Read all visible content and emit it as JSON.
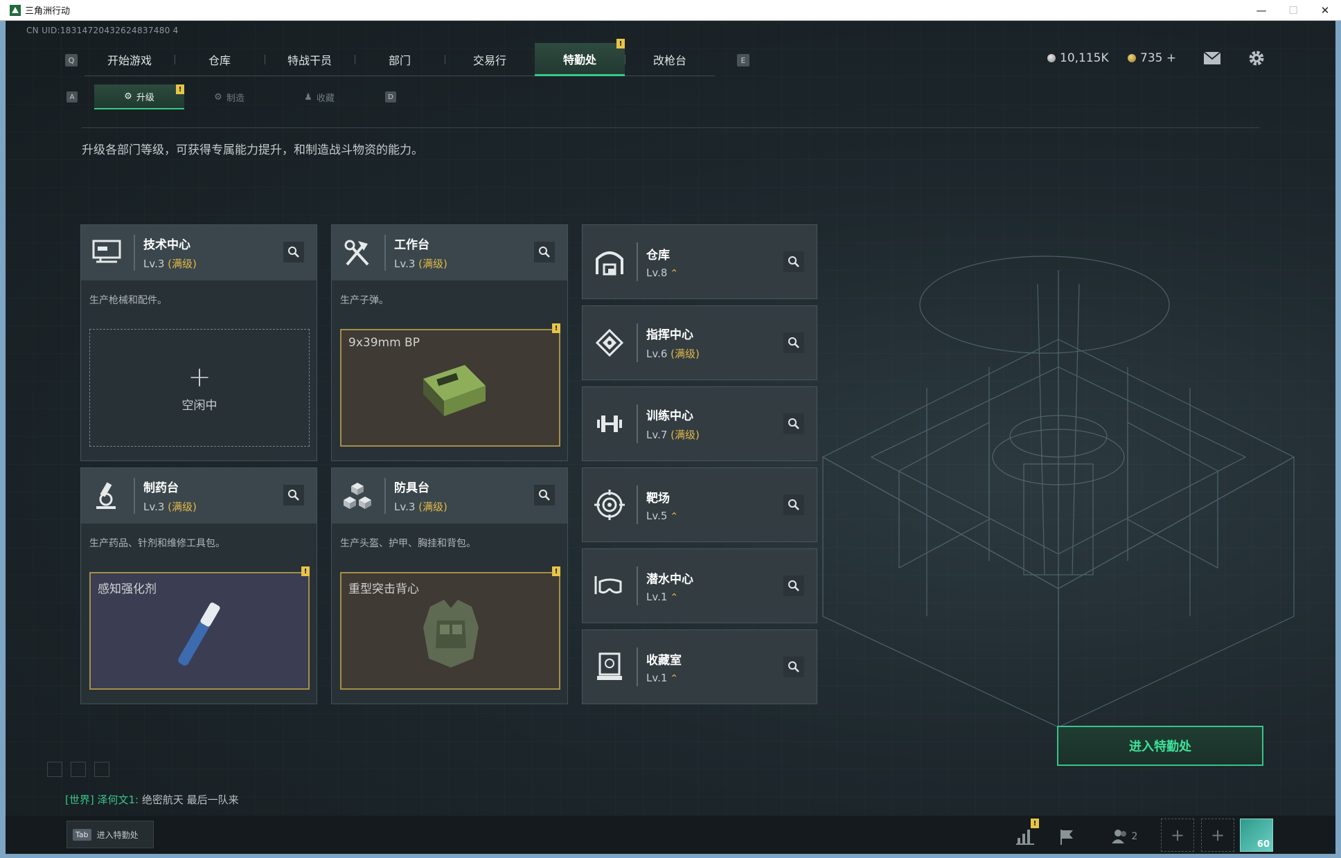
{
  "window": {
    "title": "三角洲行动",
    "controls": [
      "minimize",
      "maximize",
      "close"
    ]
  },
  "uid": "CN UID:18314720432624837480 4",
  "nav": {
    "left_key": "Q",
    "right_key": "E",
    "tabs": [
      {
        "label": "开始游戏"
      },
      {
        "label": "仓库"
      },
      {
        "label": "特战干员"
      },
      {
        "label": "部门"
      },
      {
        "label": "交易行"
      },
      {
        "label": "特勤处",
        "active": true,
        "badge": "!"
      },
      {
        "label": "改枪台"
      }
    ]
  },
  "currency": {
    "silver": "10,115K",
    "gold": "735 +"
  },
  "subnav": {
    "left_key": "A",
    "right_key": "D",
    "tabs": [
      {
        "label": "升级",
        "active": true,
        "badge": "!"
      },
      {
        "label": "制造"
      },
      {
        "label": "收藏"
      }
    ]
  },
  "description": "升级各部门等级，可获得专属能力提升，和制造战斗物资的能力。",
  "facilities": [
    {
      "name": "技术中心",
      "level": "Lv.3",
      "max": "(满级)",
      "desc": "生产枪械和配件。",
      "slot": {
        "type": "idle",
        "plus": "+",
        "label": "空闲中"
      },
      "icon": "computer-icon"
    },
    {
      "name": "工作台",
      "level": "Lv.3",
      "max": "(满级)",
      "desc": "生产子弹。",
      "slot": {
        "type": "item",
        "label": "9x39mm BP",
        "badge": "!"
      },
      "icon": "tools-icon"
    },
    {
      "name": "制药台",
      "level": "Lv.3",
      "max": "(满级)",
      "desc": "生产药品、针剂和维修工具包。",
      "slot": {
        "type": "item",
        "label": "感知强化剂",
        "badge": "!"
      },
      "icon": "microscope-icon"
    },
    {
      "name": "防具台",
      "level": "Lv.3",
      "max": "(满级)",
      "desc": "生产头盔、护甲、胸挂和背包。",
      "slot": {
        "type": "item",
        "label": "重型突击背心",
        "badge": "!"
      },
      "icon": "armor-cubes-icon"
    }
  ],
  "departments": [
    {
      "name": "仓库",
      "level": "Lv.8",
      "upgrade": "⌃",
      "icon": "warehouse-icon"
    },
    {
      "name": "指挥中心",
      "level": "Lv.6",
      "max": "(满级)",
      "icon": "command-chip-icon"
    },
    {
      "name": "训练中心",
      "level": "Lv.7",
      "max": "(满级)",
      "icon": "dumbbell-icon"
    },
    {
      "name": "靶场",
      "level": "Lv.5",
      "upgrade": "⌃",
      "icon": "target-icon"
    },
    {
      "name": "潜水中心",
      "level": "Lv.1",
      "upgrade": "⌃",
      "icon": "dive-mask-icon"
    },
    {
      "name": "收藏室",
      "level": "Lv.1",
      "upgrade": "⌃",
      "icon": "collection-icon"
    }
  ],
  "enter_button": "进入特勤处",
  "chat": {
    "channel": "[世界]",
    "sender": "泽何文1:",
    "message": "绝密航天 最后一队来"
  },
  "bottom": {
    "tab_key": "Tab",
    "tab_label": "进入特勤处",
    "friends_count": "2",
    "avatar_level": "60",
    "stats_badge": "!"
  },
  "colors": {
    "accent": "#38c88a",
    "max_level": "#e3b94a",
    "badge": "#e8c547"
  }
}
